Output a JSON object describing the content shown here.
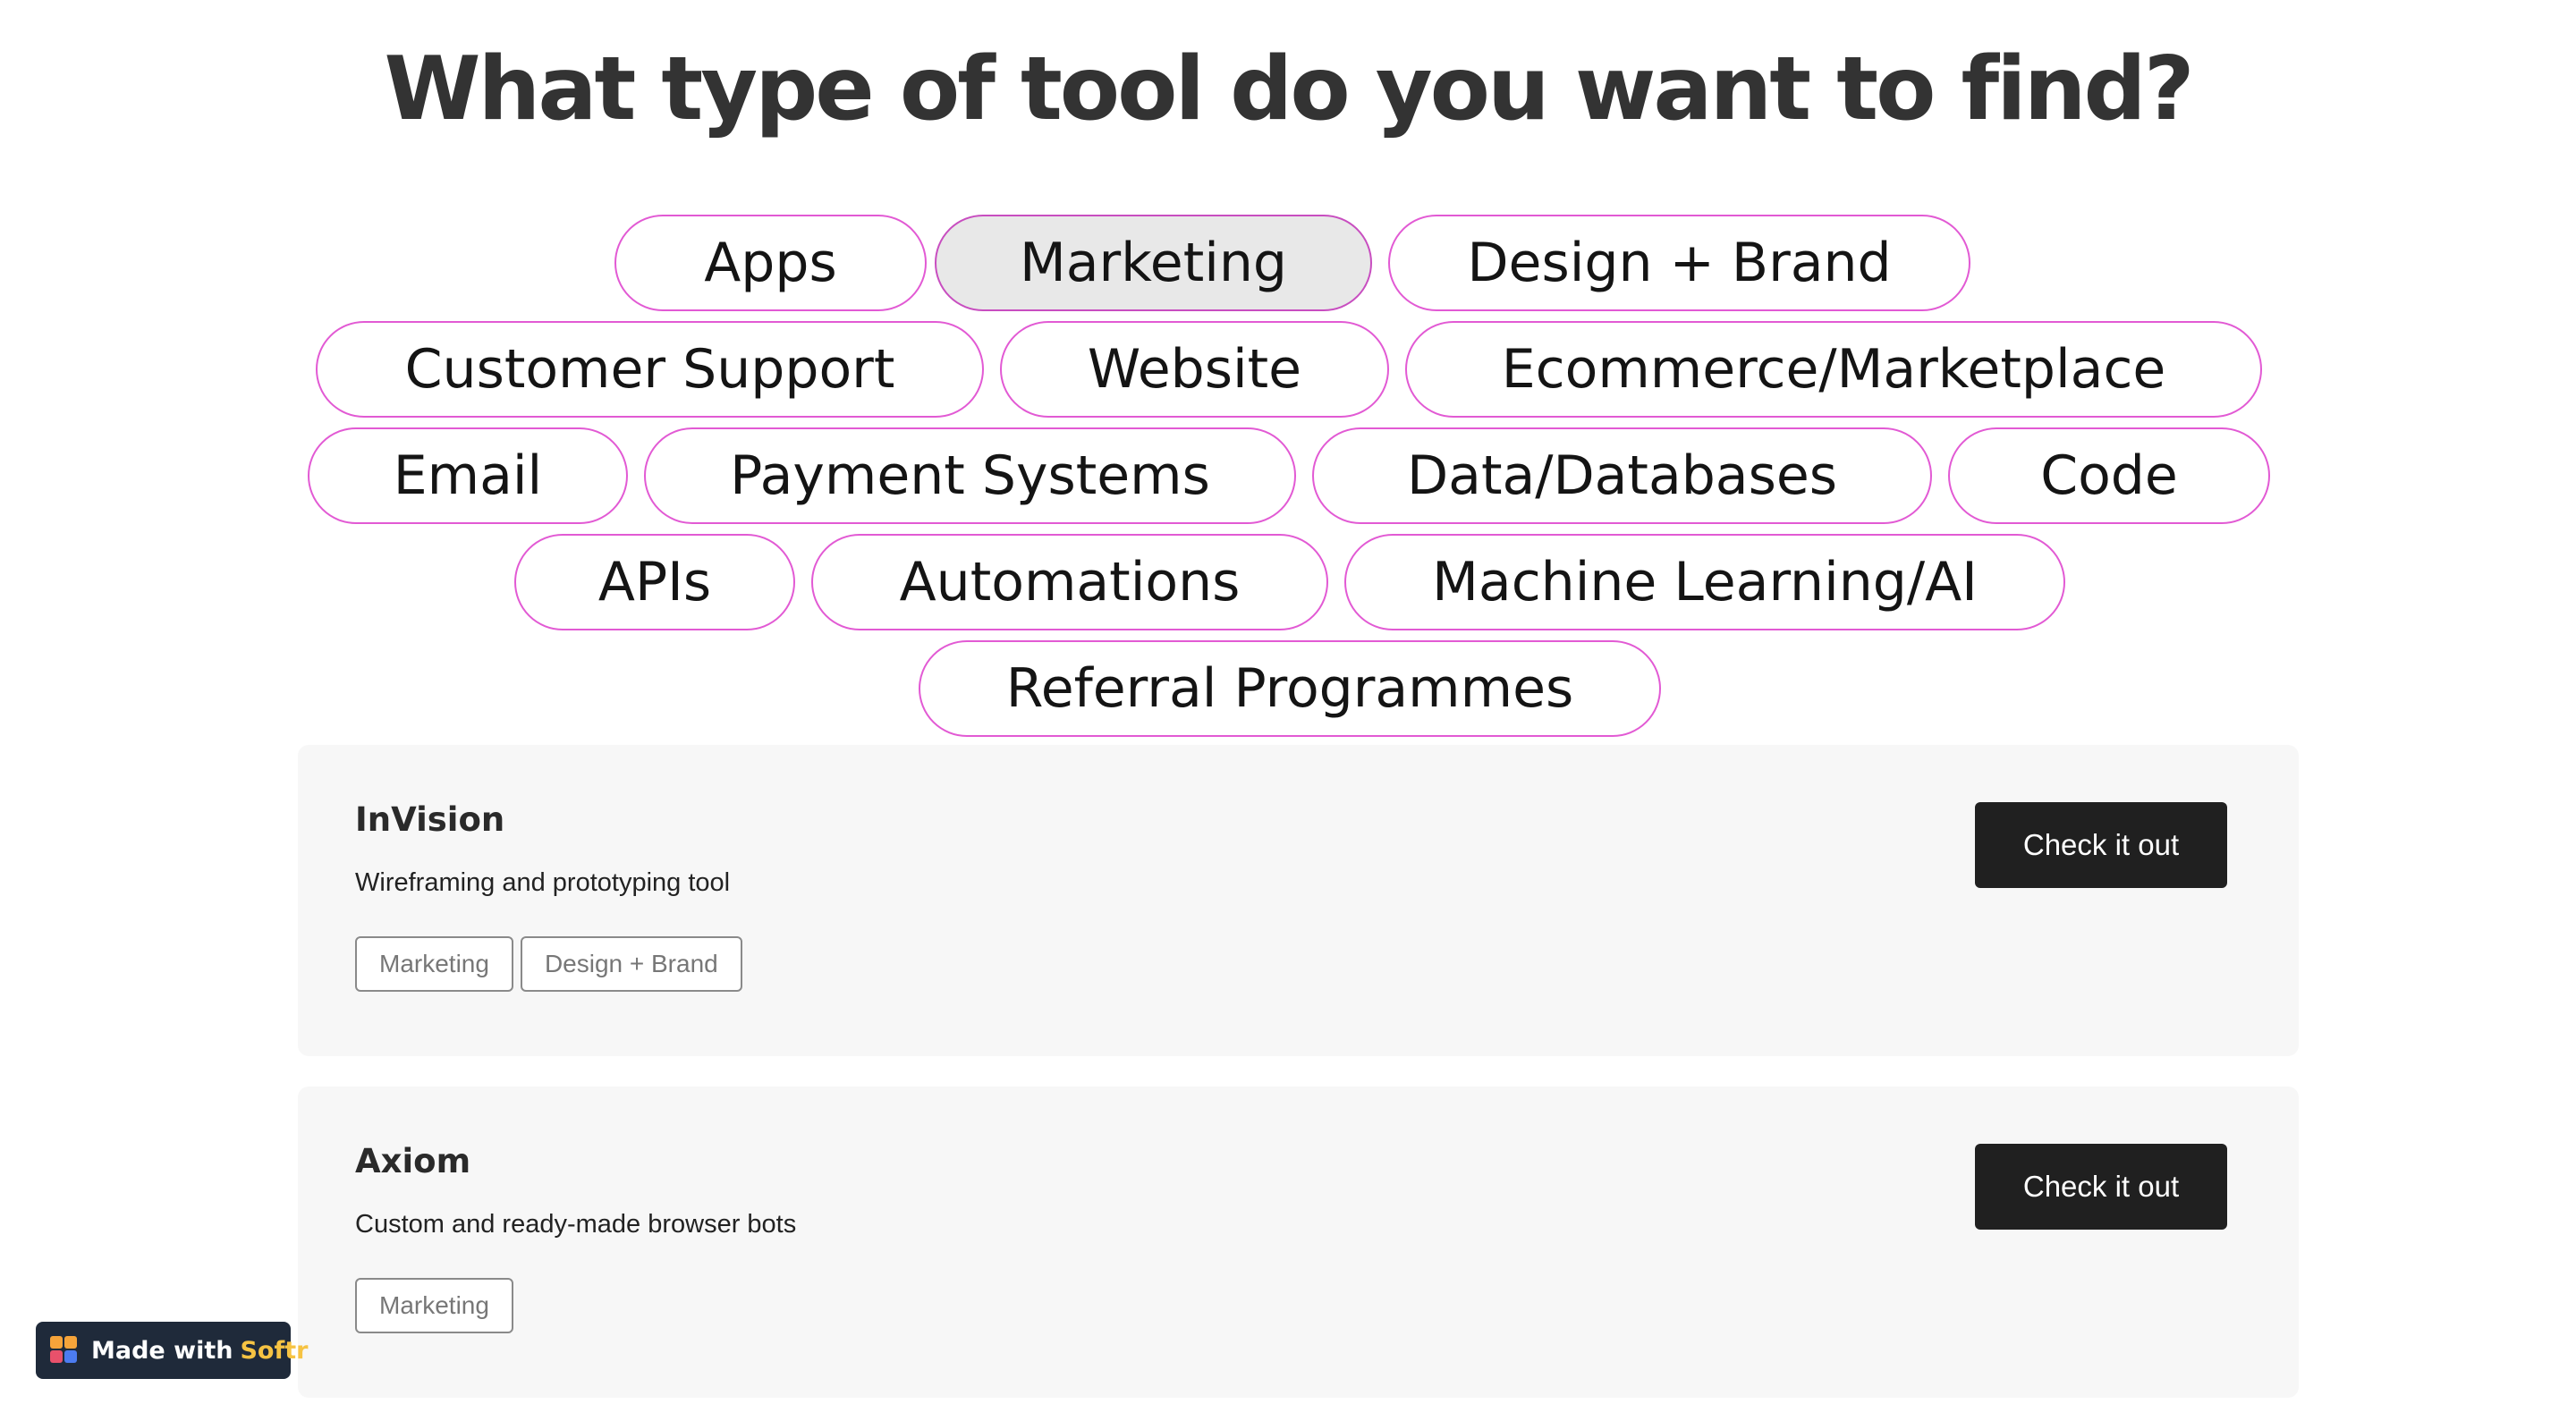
{
  "header": {
    "title": "What type of tool do you want to find?"
  },
  "filters": {
    "selected": "Marketing",
    "chips": [
      {
        "label": "Apps"
      },
      {
        "label": "Marketing"
      },
      {
        "label": "Design + Brand"
      },
      {
        "label": "Customer Support"
      },
      {
        "label": "Website"
      },
      {
        "label": "Ecommerce/Marketplace"
      },
      {
        "label": "Email"
      },
      {
        "label": "Payment Systems"
      },
      {
        "label": "Data/Databases"
      },
      {
        "label": "Code"
      },
      {
        "label": "APIs"
      },
      {
        "label": "Automations"
      },
      {
        "label": "Machine Learning/AI"
      },
      {
        "label": "Referral Programmes"
      }
    ]
  },
  "tools": [
    {
      "name": "InVision",
      "description": "Wireframing and prototyping tool",
      "tags": [
        "Marketing",
        "Design + Brand"
      ],
      "cta": "Check it out"
    },
    {
      "name": "Axiom",
      "description": "Custom and ready-made browser bots",
      "tags": [
        "Marketing"
      ],
      "cta": "Check it out"
    }
  ],
  "badge": {
    "prefix": "Made with",
    "brand": "Softr"
  },
  "colors": {
    "chip_border": "#e25ad4",
    "chip_active_bg": "#e8e8e8",
    "card_bg": "#f7f7f7",
    "button_bg": "#202020",
    "badge_bg": "#1f2a3a",
    "brand_accent": "#f6c343"
  }
}
